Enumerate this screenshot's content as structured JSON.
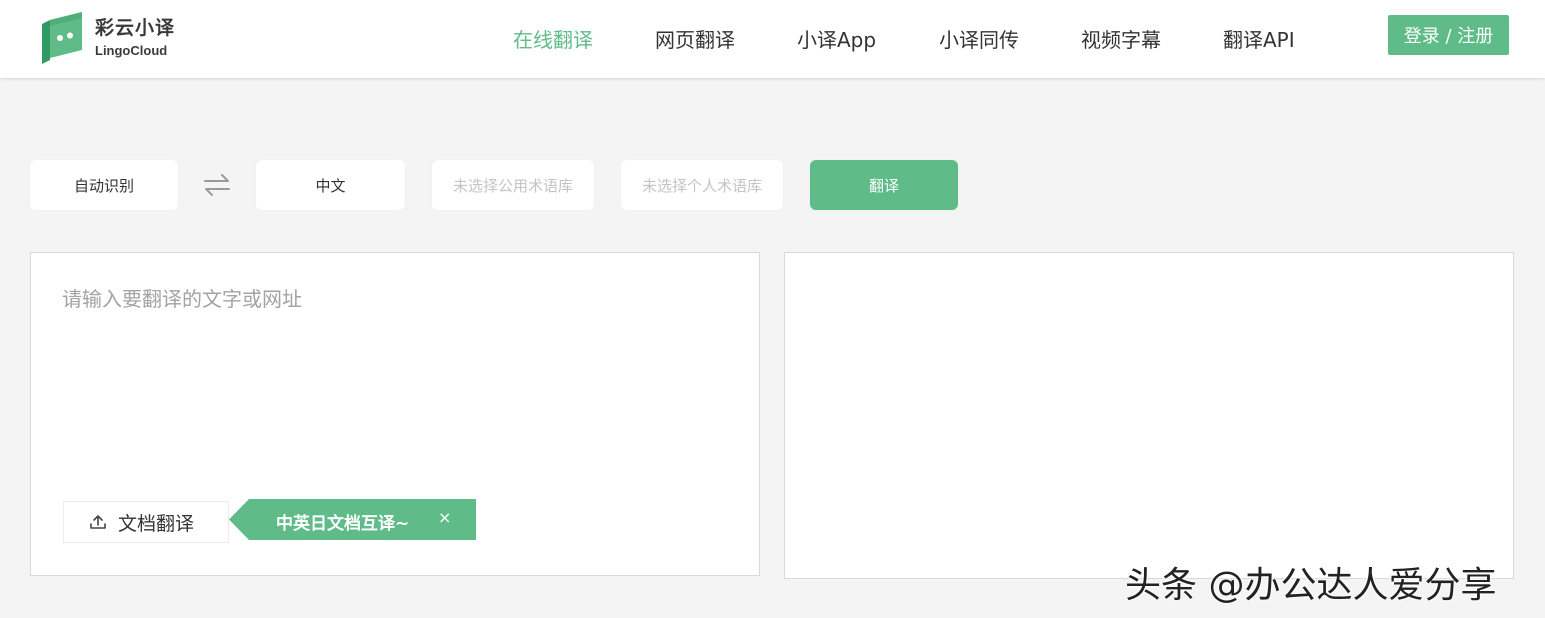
{
  "brand": {
    "name_cn": "彩云小译",
    "name_en": "LingoCloud",
    "color": "#5fbb88"
  },
  "nav": {
    "items": [
      {
        "label": "在线翻译",
        "active": true
      },
      {
        "label": "网页翻译",
        "active": false
      },
      {
        "label": "小译App",
        "active": false
      },
      {
        "label": "小译同传",
        "active": false
      },
      {
        "label": "视频字幕",
        "active": false
      },
      {
        "label": "翻译API",
        "active": false
      }
    ],
    "login_label": "登录 / 注册"
  },
  "toolbar": {
    "source_lang": "自动识别",
    "swap_icon": "swap-arrows-icon",
    "target_lang": "中文",
    "public_glossary_placeholder": "未选择公用术语库",
    "personal_glossary_placeholder": "未选择个人术语库",
    "translate_label": "翻译"
  },
  "source_panel": {
    "input_placeholder": "请输入要翻译的文字或网址",
    "input_value": "",
    "doc_button_label": "文档翻译",
    "doc_icon": "upload-icon",
    "promo_tag": "中英日文档互译~",
    "promo_close": "×"
  },
  "result_panel": {
    "text": ""
  },
  "watermark": "头条 @办公达人爱分享"
}
